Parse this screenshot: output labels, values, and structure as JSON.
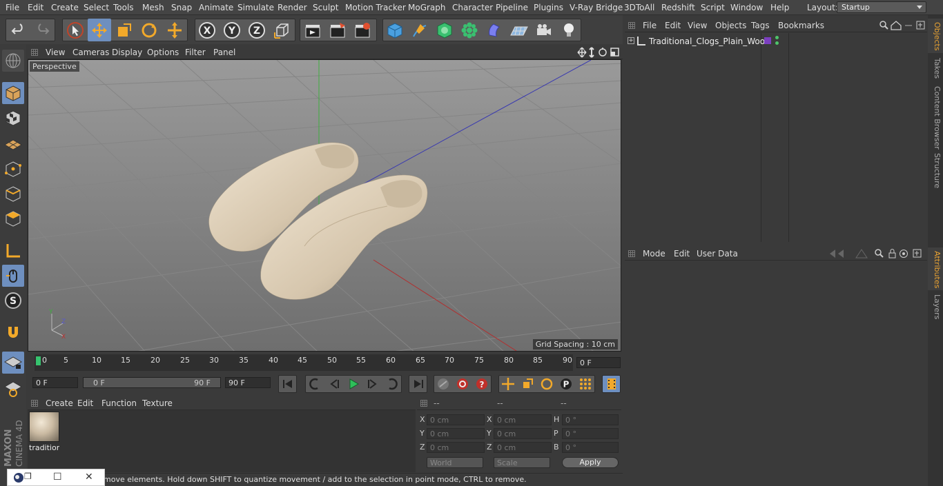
{
  "menubar": {
    "items": [
      "File",
      "Edit",
      "Create",
      "Select",
      "Tools",
      "Mesh",
      "Snap",
      "Animate",
      "Simulate",
      "Render",
      "Sculpt",
      "Motion Tracker",
      "MoGraph",
      "Character",
      "Pipeline",
      "Plugins",
      "V-Ray Bridge",
      "3DToAll",
      "Redshift",
      "Script",
      "Window",
      "Help"
    ],
    "layout_label": "Layout:",
    "layout_value": "Startup"
  },
  "toolbar": {
    "axis_x": "X",
    "axis_y": "Y",
    "axis_z": "Z"
  },
  "viewport": {
    "menu": [
      "View",
      "Cameras",
      "Display",
      "Options",
      "Filter",
      "Panel"
    ],
    "camera_label": "Perspective",
    "grid_spacing": "Grid Spacing : 10 cm"
  },
  "timeline": {
    "ticks": [
      "0",
      "5",
      "10",
      "15",
      "20",
      "25",
      "30",
      "35",
      "40",
      "45",
      "50",
      "55",
      "60",
      "65",
      "70",
      "75",
      "80",
      "85",
      "90"
    ],
    "current_frame": "0 F",
    "start_frame": "0 F",
    "range_start": "0 F",
    "range_end": "90 F",
    "end_frame": "90 F"
  },
  "material_manager": {
    "menu": [
      "Create",
      "Edit",
      "Function",
      "Texture"
    ],
    "material_name": "tradition"
  },
  "coordinates": {
    "headers": [
      "--",
      "--",
      "--"
    ],
    "pos_labels": [
      "X",
      "Y",
      "Z"
    ],
    "pos_values": [
      "0 cm",
      "0 cm",
      "0 cm"
    ],
    "size_labels": [
      "X",
      "Y",
      "Z"
    ],
    "size_values": [
      "0 cm",
      "0 cm",
      "0 cm"
    ],
    "rot_labels": [
      "H",
      "P",
      "B"
    ],
    "rot_values": [
      "0 °",
      "0 °",
      "0 °"
    ],
    "mode_world": "World",
    "mode_scale": "Scale",
    "apply": "Apply"
  },
  "status": {
    "text": "move elements. Hold down SHIFT to quantize movement / add to the selection in point mode, CTRL to remove."
  },
  "object_manager": {
    "menu": [
      "File",
      "Edit",
      "View",
      "Objects",
      "Tags",
      "Bookmarks"
    ],
    "object_name": "Traditional_Clogs_Plain_Wood",
    "tag_color": "#7b3fbf"
  },
  "attributes": {
    "menu": [
      "Mode",
      "Edit",
      "User Data"
    ]
  },
  "right_tabs": [
    "Objects",
    "Takes",
    "Content Browser",
    "Structure",
    "Attributes",
    "Layers"
  ],
  "brand": {
    "maxon": "MAXON",
    "product": "CINEMA 4D"
  }
}
